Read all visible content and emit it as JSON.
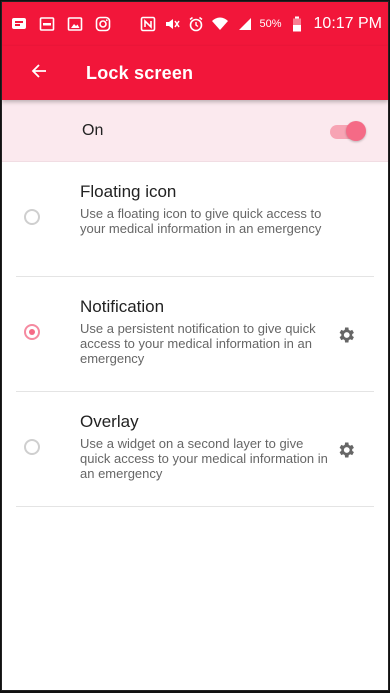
{
  "status_bar": {
    "battery_percent": "50%",
    "time": "10:17 PM",
    "icons": [
      "message-icon",
      "app-icon",
      "image-icon",
      "instagram-icon",
      "nfc-icon",
      "mute-icon",
      "alarm-icon",
      "wifi-icon",
      "signal-icon",
      "battery-icon"
    ]
  },
  "app_bar": {
    "title": "Lock screen",
    "back_icon": "back-arrow-icon"
  },
  "toggle": {
    "label": "On",
    "state": "on"
  },
  "options": [
    {
      "title": "Floating icon",
      "description": "Use a floating icon to give quick access to your medical information in an emergency",
      "selected": false,
      "has_settings": false
    },
    {
      "title": "Notification",
      "description": "Use a persistent notification to give quick access to your medical information in an emergency",
      "selected": true,
      "has_settings": true
    },
    {
      "title": "Overlay",
      "description": "Use a widget on a second layer to give quick access to your medical information in an emergency",
      "selected": false,
      "has_settings": true
    }
  ],
  "colors": {
    "primary": "#f2163a",
    "accent": "#f56a86",
    "toggle_row_bg": "#fbe9ee"
  }
}
